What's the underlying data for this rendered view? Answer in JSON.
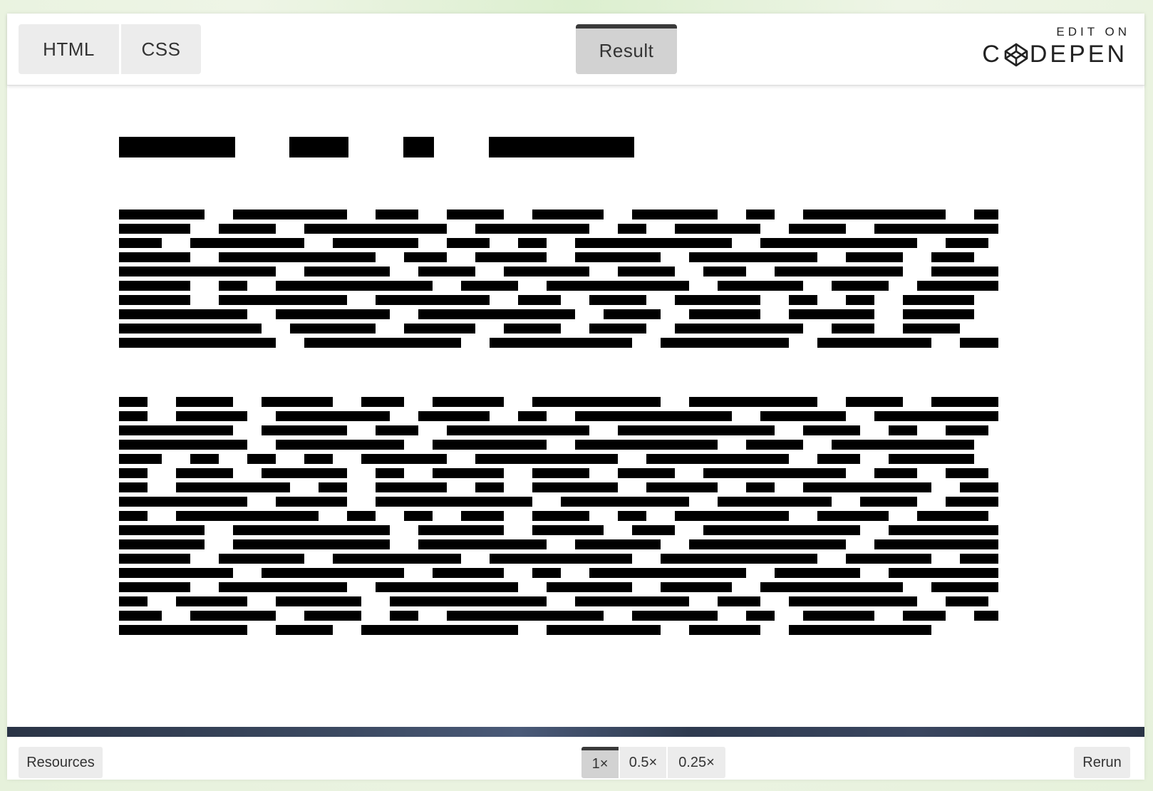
{
  "header": {
    "tabs": [
      {
        "label": "HTML"
      },
      {
        "label": "CSS"
      },
      {
        "label": "Result"
      }
    ],
    "brand": {
      "edit_on": "EDIT ON",
      "name_before": "C",
      "name_after": "DEPEN"
    }
  },
  "footer": {
    "resources_label": "Resources",
    "zoom_options": [
      {
        "label": "1×"
      },
      {
        "label": "0.5×"
      },
      {
        "label": "0.25×"
      }
    ],
    "rerun_label": "Rerun"
  },
  "colors": {
    "redaction": "#000000",
    "active_accent": "#3a3a3a"
  },
  "icons": {
    "logo": "codepen-logo-icon"
  }
}
